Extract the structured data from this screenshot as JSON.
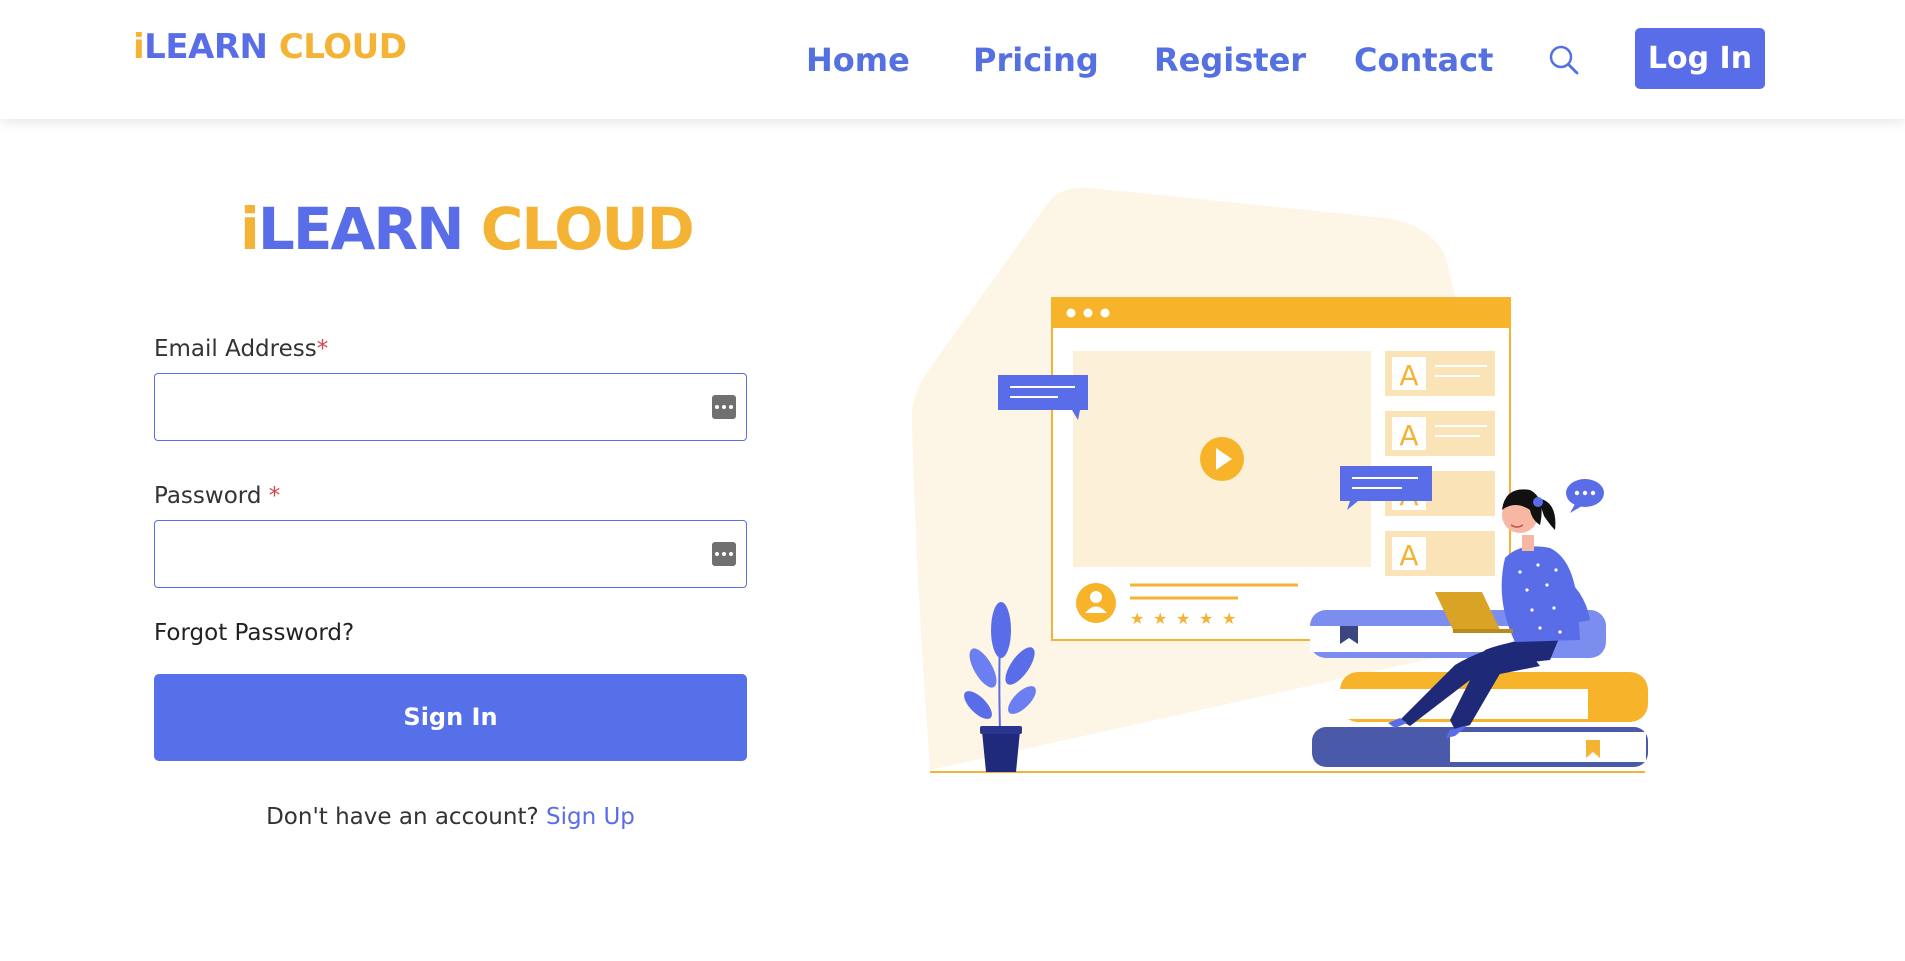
{
  "header": {
    "brand": {
      "i": "i",
      "learn": "LEARN",
      "cloud": "CLOUD"
    },
    "nav": [
      {
        "label": "Home"
      },
      {
        "label": "Pricing"
      },
      {
        "label": "Register"
      },
      {
        "label": "Contact"
      }
    ],
    "search_icon": "search-icon",
    "login_label": "Log In"
  },
  "login_form": {
    "brand": {
      "i": "i",
      "learn": "LEARN",
      "cloud": "CLOUD"
    },
    "email_label": "Email Address",
    "email_value": "",
    "password_label": "Password ",
    "password_value": "",
    "required_mark": "*",
    "forgot_label": "Forgot Password?",
    "signin_label": "Sign In",
    "no_account_text": "Don't have an account? ",
    "signup_label": "Sign Up"
  },
  "illustration": {
    "description_icon": "online-learning-illustration",
    "card_letter": "A"
  },
  "colors": {
    "primary": "#5a6de8",
    "accent": "#f5b335",
    "required": "#d64545",
    "illustration_bg": "#fdf5e6"
  }
}
